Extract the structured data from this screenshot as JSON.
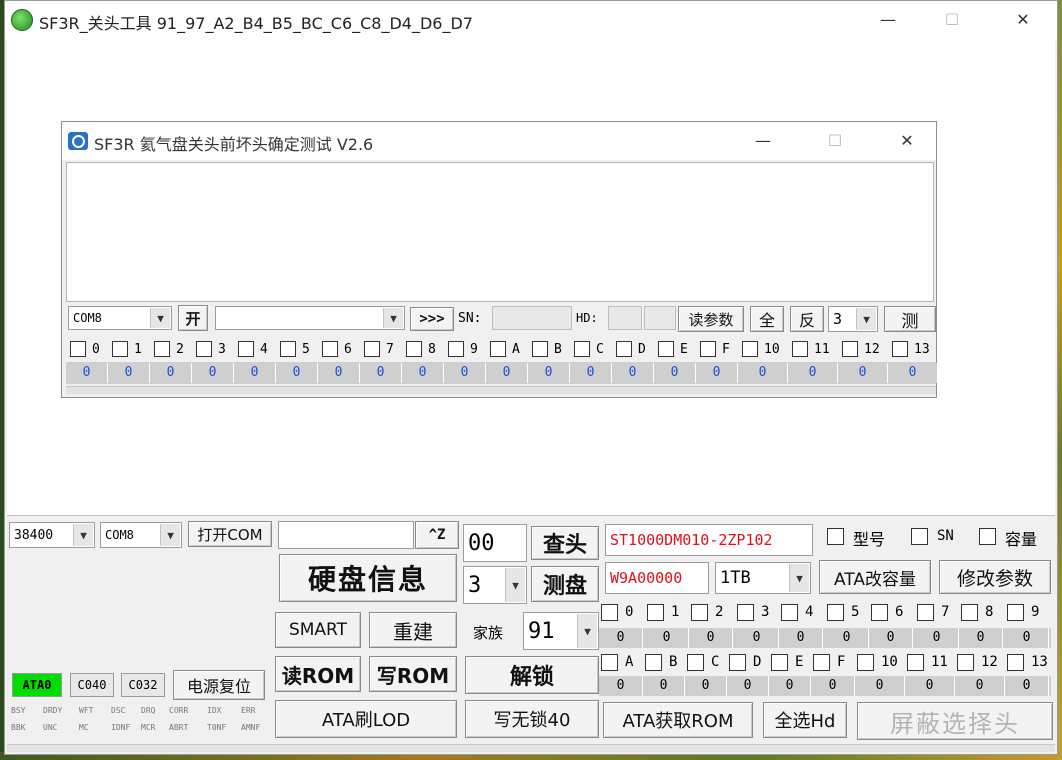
{
  "main_window": {
    "title": "SF3R_关头工具 91_97_A2_B4_B5_BC_C6_C8_D4_D6_D7",
    "min": "—",
    "max": "☐",
    "close": "✕"
  },
  "dialog": {
    "title": "SF3R 氦气盘关头前坏头确定测试 V2.6",
    "min": "—",
    "max": "☐",
    "close": "✕",
    "com_value": "COM8",
    "open_label": "开",
    "arrow_label": ">>>",
    "sn_label": "SN:",
    "hd_label": "HD:",
    "read_param_label": "读参数",
    "all_label": "全",
    "invert_label": "反",
    "count_value": "3",
    "test_label": "测",
    "heads": [
      "0",
      "1",
      "2",
      "3",
      "4",
      "5",
      "6",
      "7",
      "8",
      "9",
      "A",
      "B",
      "C",
      "D",
      "E",
      "F",
      "10",
      "11",
      "12",
      "13"
    ],
    "values": [
      "0",
      "0",
      "0",
      "0",
      "0",
      "0",
      "0",
      "0",
      "0",
      "0",
      "0",
      "0",
      "0",
      "0",
      "0",
      "0",
      "0",
      "0",
      "0",
      "0"
    ]
  },
  "bottom": {
    "baud": "38400",
    "com": "COM8",
    "open_com_label": "打开COM",
    "cmd_field": "",
    "z_label": "^Z",
    "disk_info_label": "硬盘信息",
    "smart_label": "SMART",
    "rebuild_label": "重建",
    "read_rom_label": "读ROM",
    "write_rom_label": "写ROM",
    "ata_flash_lod_label": "ATA刷LOD",
    "ata0": "ATA0",
    "c040": "C040",
    "c032": "C032",
    "power_reset_label": "电源复位",
    "status_top": [
      "BSY",
      "DRDY",
      "WFT",
      "DSC",
      "DRQ",
      "CORR",
      "IDX",
      "ERR"
    ],
    "status_bottom": [
      "BBK",
      "UNC",
      "MC",
      "IDNF",
      "MCR",
      "ABRT",
      "T0NF",
      "AMNF"
    ],
    "hex_field": "00",
    "find_head_label": "查头",
    "head_count": "3",
    "test_disk_label": "测盘",
    "family_label": "家族",
    "family_value": "91",
    "unlock_label": "解锁",
    "write_nolock_label": "写无锁40",
    "model": "ST1000DM010-2ZP102",
    "serial": "W9A00000",
    "capacity": "1TB",
    "chk_model": "型号",
    "chk_sn": "SN",
    "chk_capacity": "容量",
    "ata_change_cap_label": "ATA改容量",
    "modify_param_label": "修改参数",
    "ata_get_rom_label": "ATA获取ROM",
    "select_all_hd_label": "全选Hd",
    "mask_select_label": "屏蔽选择头",
    "heads_row1": [
      "0",
      "1",
      "2",
      "3",
      "4",
      "5",
      "6",
      "7",
      "8",
      "9"
    ],
    "values_row1": [
      "0",
      "0",
      "0",
      "0",
      "0",
      "0",
      "0",
      "0",
      "0",
      "0"
    ],
    "heads_row2": [
      "A",
      "B",
      "C",
      "D",
      "E",
      "F",
      "10",
      "11",
      "12",
      "13"
    ],
    "values_row2": [
      "0",
      "0",
      "0",
      "0",
      "0",
      "0",
      "0",
      "0",
      "0",
      "0"
    ]
  },
  "colors": {
    "ata0_bg": "#00dd00",
    "red_text": "#e0101a",
    "blue_value": "#1a4fd8"
  }
}
